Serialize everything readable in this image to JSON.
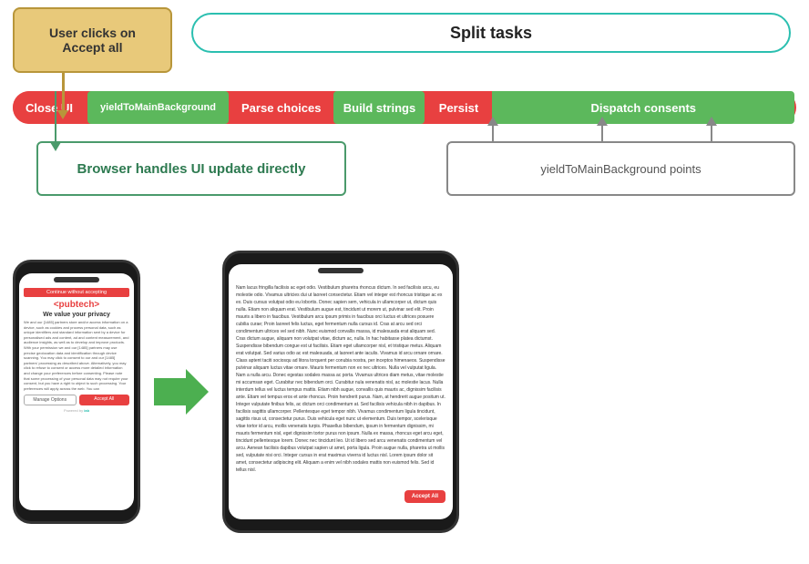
{
  "diagram": {
    "user_clicks_label": "User clicks on\nAccept all",
    "split_tasks_label": "Split tasks",
    "pipeline": {
      "close_ui": "Close UI",
      "yield_1": "yieldToMainBackground",
      "parse_choices": "Parse choices",
      "build_strings": "Build strings",
      "persist": "Persist",
      "dispatch_consents": "Dispatch consents"
    },
    "browser_ui_label": "Browser handles UI update directly",
    "yield_points_label": "yieldToMainBackground  points"
  },
  "phones": {
    "phone1": {
      "top_bar": "Continue without accepting",
      "logo": "<pubtech>",
      "privacy_heading": "We value your privacy",
      "body_text": "We and our [1485] partners store and/or access information on a device, such as cookies and process personal data, such as unique identifiers and standard information sent by a device for personalised ads and content, ad and content measurement, and audience insights, as well as to develop and improve products. With your permission we and our [1485] partners may use precise geolocation data and identification through device scanning. You may click to consent to our and our [1485] partners' processing as described above. Alternatively, you may click to refuse to consent or access more detailed information and change your preferences before consenting. Please note that some processing of your personal data may not require your consent, but you have a right to object to such processing. Your preferences will apply across the web. You can",
      "manage_label": "Manage Options",
      "accept_label": "Accept All",
      "footer": "Powered by"
    },
    "phone2": {
      "article_text": "Nam lacus fringilla facilisis ac eget odio. Vestibulum pharetra rhoncus dictum. In sed facilisis arcu, eu molestie odio. Vivamus ultricies dui ut laoreet consectetur. Etiam vel integer est rhoncus tristique ac ex ex. Duis cursus volutpat odio eu lobortis. Donec sapien sem, vehicula in ullamcorper ut, dictum quis nulla. Etiam non aliquam erat. Vestibulum augue est, tincidunt ut morem ut, pulvinar sed elit. Proin mauris a libero in faucibus. Vestibulum arcu ipsum primis in faucibus orci luctus et ultrices posuere cubilia curae; Proin laoreet felis luctus, eget fermentum nulla cursus id. Cras at arcu sed orci condimentum ultrices vel sed nibh. Nunc euismod convallis massa, id malesuada erat aliquam sed. Cras dictum augue, aliquam non volutpat vitae, dictum ac, nulla. In hac habitasse platea dictumst. Suspendisse bibendum congue est ut facilisis. Etiam eget ullamcorper nisl, et tristique metus. Aliquam erat volutpat. Sed varius odio ac est malesuada, at laoreet ante iaculis. Vivamus id arcu ornare ornare. Class aptent taciti sociosqu ad litora torquent per conubia nostra, per inceptos himenaeos. Suspendisse pulvinar aliquam luctus vitae ornare. Mauris fermentum non ex nec ultrices. Nulla vel vulputat ligula. Nam a nulla arcu. Donec egestas sodales massa ac porta. Vivamus ultrices diam metus, vitae molestie mi accumsan eget. Curabitur nec bibendum orci. Curabitur nula venenatis nisl, ac molestie lacus. Nulla interdum tellus vel luctus tempus mattis. Etiam nibh augue, convallis quis mauris ac, dignissim facilisis ante. Etiam vel tempus eros et ante rhoncus. Proin hendrerit purus. Nam, at hendrerit augue positum ut. Integer vulputate finibus felis, ac dictum orci condimentum at. Sed facilisis vehicula nibh in dapibus. In facilisis sagittis ullamcorper. Pellentesque eget tempor nibh. Vivamus condimentum ligula tincidunt, sagittis risus ut, consectetur purus. Duis vehicula eget nunc ut elementum. Duis tempor, scelerisque vitae tortor id arcu, mollis venenatis turpis. Phasellus bibendum, ipsum in fermentum dignissim, mi mauris fermentum nisl, eget dignissim tortor purus non ipsum. Nulla ex massa, rhoncus eget arcu eget, tincidunt pellentesque lorem. Donec nec tincidunt leo. Ut id libero sed arcu venenatis condimentum vel arcu. Aenean facilisis dapibus volutpat sapien ut amet, porta ligula. Proin augue nulla, pharetra ut mollis sed, vulputate nisi orci. Integer cursus in erat maximus viverra id luctus nisl. Lorem ipsum dolor sit amet, consectetur adipiscing elit. Aliquam a enim vel nibh sodales mattis non euismod felis. Sed id tellus nisl.",
      "accept_all": "Accept All"
    }
  }
}
